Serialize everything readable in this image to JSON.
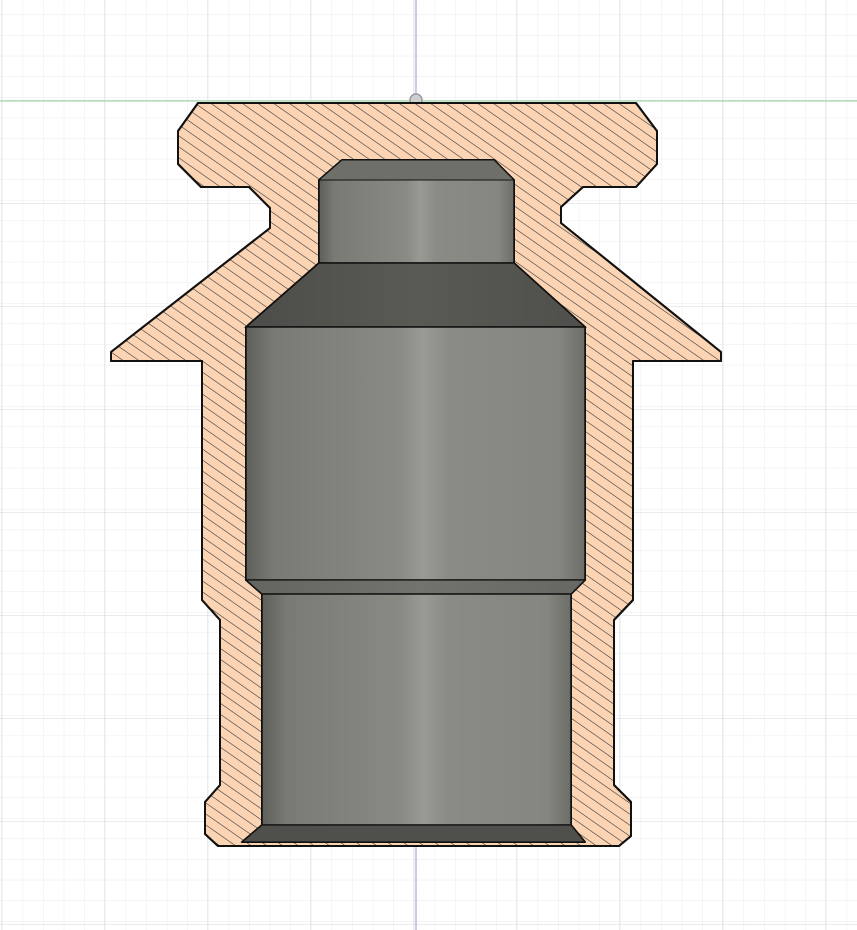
{
  "viewport": {
    "background_color": "#ffffff",
    "grid_minor_color": "#e9ebee",
    "grid_major_color": "#d4d7dc",
    "axis_vertical_color": "#a6a6df",
    "axis_horizontal_color": "#a8dcb0"
  },
  "section_view": {
    "hatch_fill_color": "#fbd4b4",
    "hatch_line_color": "#2b2b2b",
    "outline_color": "#111111",
    "cavity_color": "#858580"
  },
  "icons": {
    "origin": "origin-marker-icon"
  }
}
